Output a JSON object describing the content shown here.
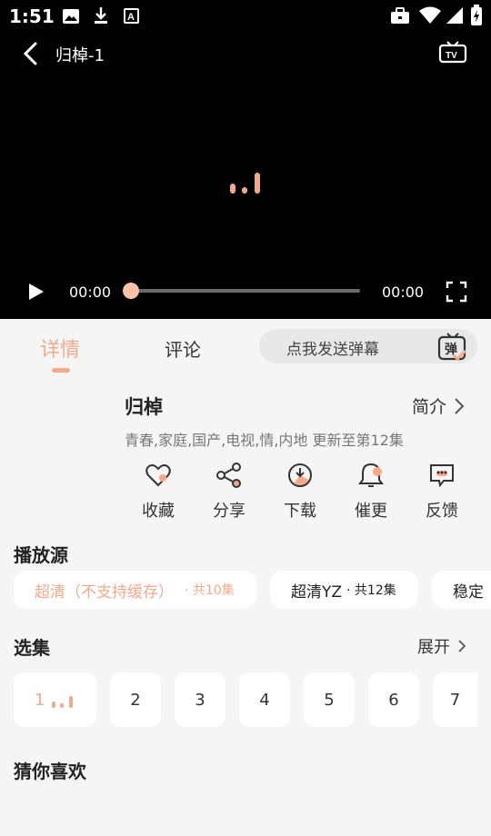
{
  "status_bar": {
    "time": "1:51"
  },
  "player": {
    "title": "归棹-1",
    "current_time": "00:00",
    "total_time": "00:00",
    "progress": 0
  },
  "tabs": [
    {
      "label": "详情"
    },
    {
      "label": "评论"
    }
  ],
  "danmu": {
    "placeholder": "点我发送弹幕",
    "icon_text": "弹"
  },
  "show": {
    "title": "归棹",
    "intro_label": "简介",
    "meta": "青春,家庭,国产,电视,情,内地 更新至第12集"
  },
  "actions": [
    {
      "label": "收藏",
      "icon": "heart-icon"
    },
    {
      "label": "分享",
      "icon": "share-icon"
    },
    {
      "label": "下载",
      "icon": "download-icon"
    },
    {
      "label": "催更",
      "icon": "bell-icon"
    },
    {
      "label": "反馈",
      "icon": "feedback-icon"
    }
  ],
  "sources": {
    "title": "播放源",
    "items": [
      {
        "name": "超清（不支持缓存）",
        "count": "· 共10集",
        "selected": true
      },
      {
        "name": "超清YZ",
        "count": "· 共12集",
        "selected": false
      },
      {
        "name": "稳定",
        "count": "",
        "selected": false
      }
    ]
  },
  "episodes": {
    "title": "选集",
    "expand_label": "展开",
    "items": [
      "1",
      "2",
      "3",
      "4",
      "5",
      "6",
      "7"
    ]
  },
  "recommend": {
    "title": "猜你喜欢"
  },
  "colors": {
    "accent": "#f3a98a",
    "player_bg": "#000000",
    "page_bg": "#f5f5f5"
  }
}
